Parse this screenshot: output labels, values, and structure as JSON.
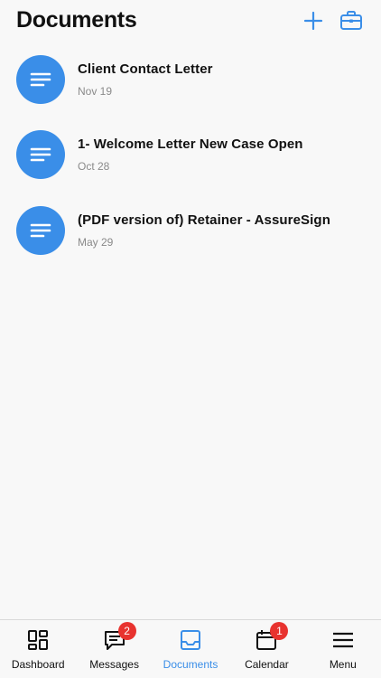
{
  "header": {
    "title": "Documents",
    "add_icon": "plus-icon",
    "briefcase_icon": "briefcase-icon"
  },
  "documents": [
    {
      "title": "Client Contact Letter",
      "date": "Nov 19",
      "icon": "document-lines-icon"
    },
    {
      "title": "1- Welcome Letter New Case Open",
      "date": "Oct 28",
      "icon": "document-lines-icon"
    },
    {
      "title": "(PDF version of) Retainer - AssureSign",
      "date": "May 29",
      "icon": "document-lines-icon"
    }
  ],
  "tabbar": {
    "active": "Documents",
    "tabs": [
      {
        "label": "Dashboard",
        "icon": "dashboard-icon"
      },
      {
        "label": "Messages",
        "icon": "message-icon",
        "badge": "2"
      },
      {
        "label": "Documents",
        "icon": "inbox-icon"
      },
      {
        "label": "Calendar",
        "icon": "calendar-icon",
        "badge": "1"
      },
      {
        "label": "Menu",
        "icon": "hamburger-icon"
      }
    ]
  },
  "colors": {
    "accent": "#3a8ee8",
    "badge": "#e8332f",
    "background": "#f8f8f8"
  }
}
